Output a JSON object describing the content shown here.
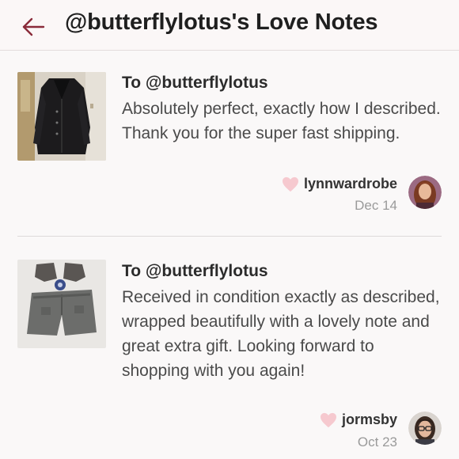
{
  "header": {
    "title": "@butterflylotus's Love Notes",
    "back_icon": "back-arrow-icon",
    "accent_color": "#8a2b3a"
  },
  "notes": [
    {
      "thumbnail_icon": "leather-jacket-photo",
      "to": "To @butterflylotus",
      "message": "Absolutely perfect, exactly how I described. Thank you for the super fast shipping.",
      "author": "lynnwardrobe",
      "date": "Dec 14",
      "heart_color": "#f6c9cf"
    },
    {
      "thumbnail_icon": "jeans-and-boots-photo",
      "to": "To @butterflylotus",
      "message": "Received in condition exactly as described, wrapped beautifully with a lovely note and great extra gift. Looking forward to shopping with you again!",
      "author": "jormsby",
      "date": "Oct 23",
      "heart_color": "#f6c9cf"
    }
  ]
}
